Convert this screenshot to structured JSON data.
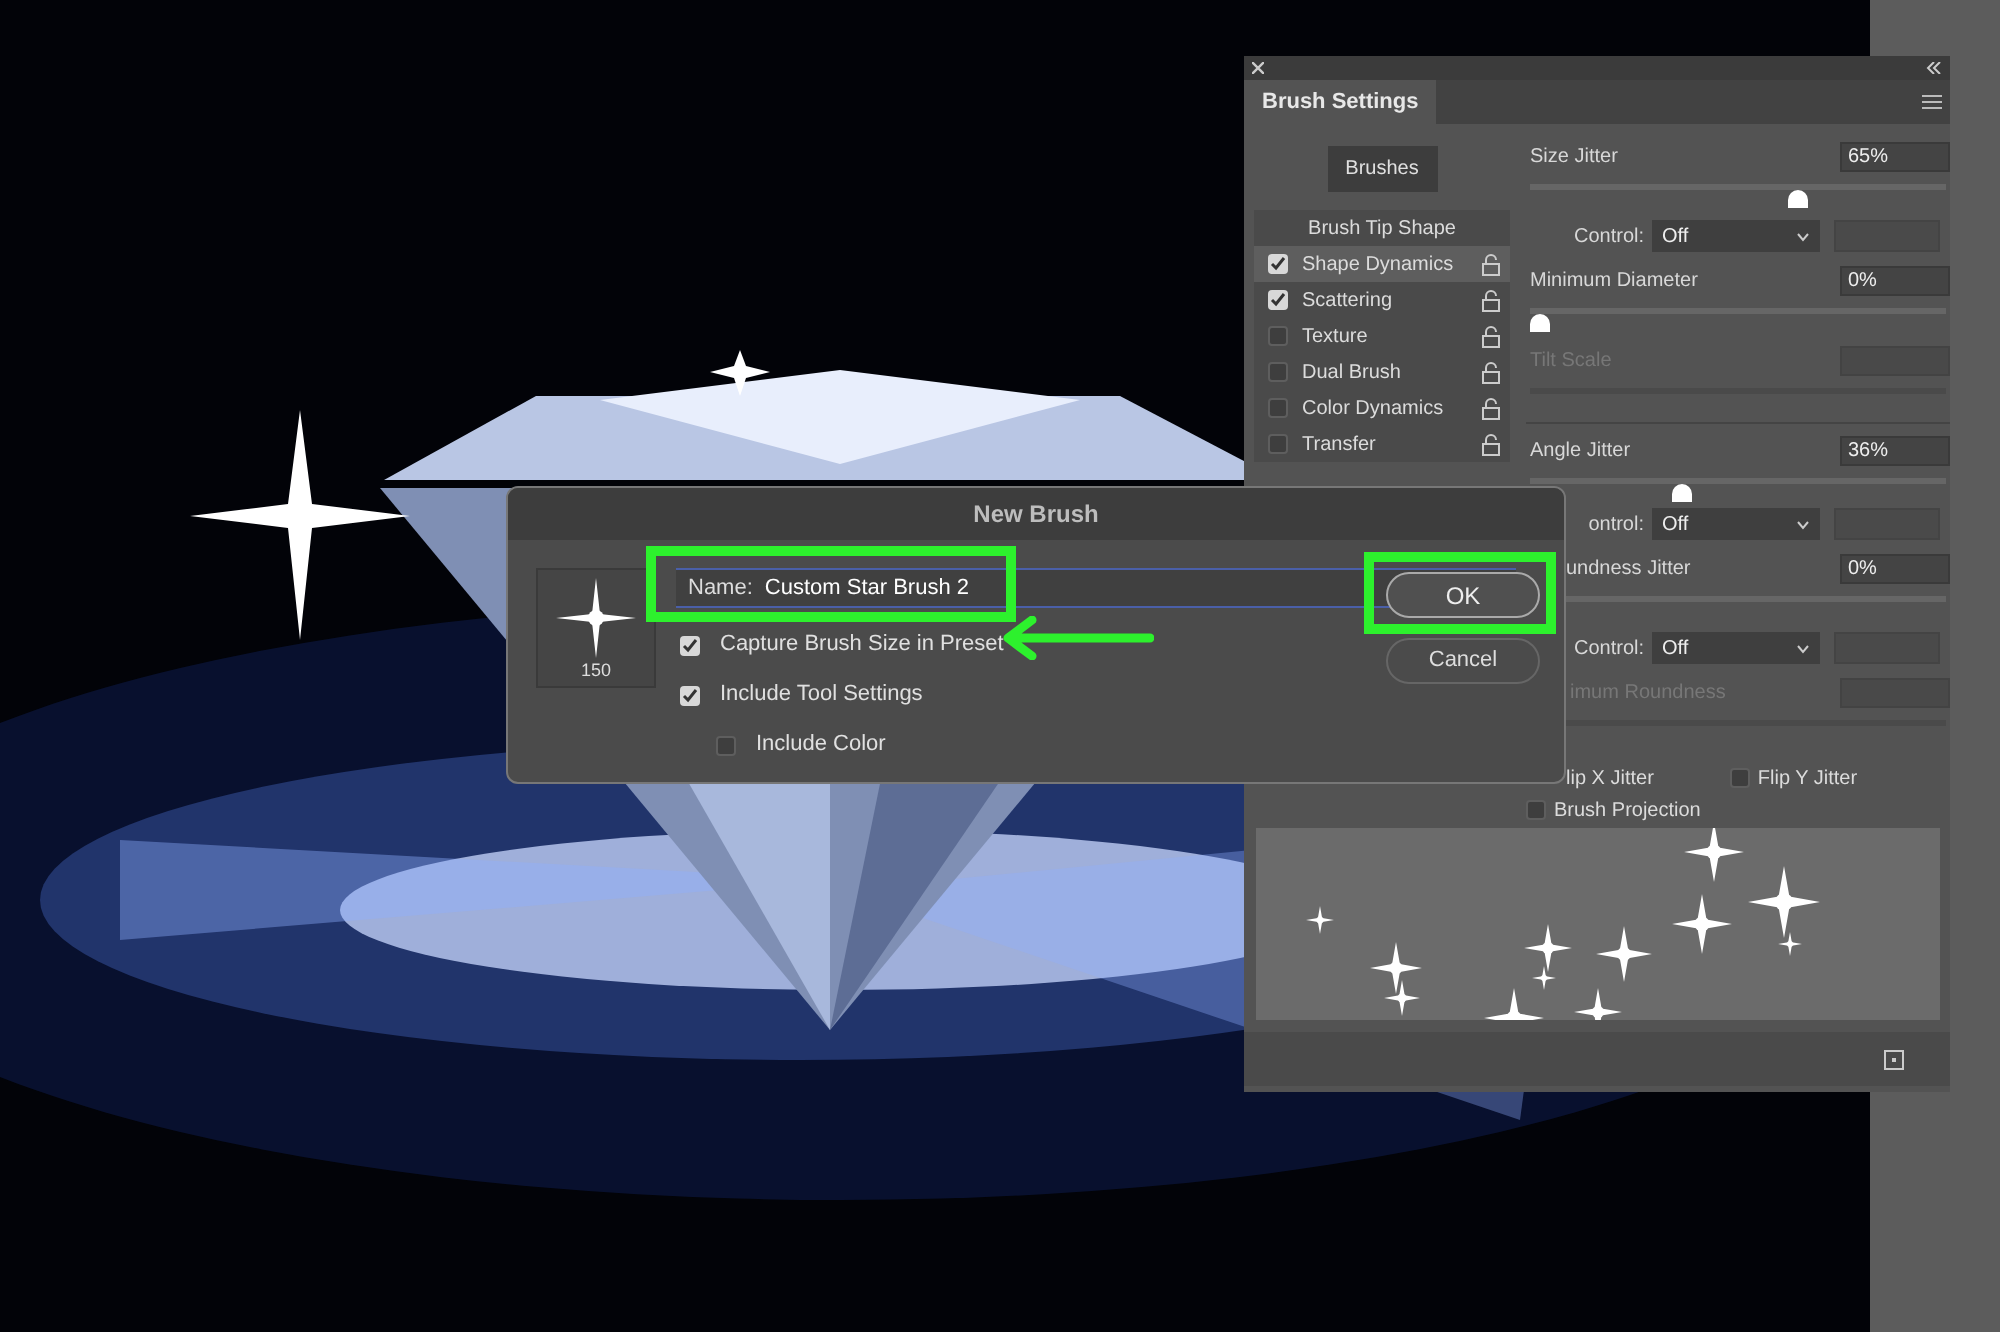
{
  "brush_settings": {
    "title": "Brush Settings",
    "brushes_button": "Brushes",
    "section_header": "Brush Tip Shape",
    "options": [
      {
        "label": "Shape Dynamics",
        "checked": true,
        "selected": true
      },
      {
        "label": "Scattering",
        "checked": true,
        "selected": false
      },
      {
        "label": "Texture",
        "checked": false,
        "selected": false
      },
      {
        "label": "Dual Brush",
        "checked": false,
        "selected": false
      },
      {
        "label": "Color Dynamics",
        "checked": false,
        "selected": false
      },
      {
        "label": "Transfer",
        "checked": false,
        "selected": false
      }
    ],
    "controls": [
      {
        "kind": "slider",
        "label": "Size Jitter",
        "value": "65%",
        "level": 0.65
      },
      {
        "kind": "dropdown",
        "label": "Control:",
        "value": "Off"
      },
      {
        "kind": "slider",
        "label": "Minimum Diameter",
        "value": "0%",
        "level": 0
      },
      {
        "kind": "slider",
        "label": "Tilt Scale",
        "disabled": true
      },
      {
        "kind": "slider",
        "label": "Angle Jitter",
        "value": "36%",
        "level": 0.36
      },
      {
        "kind": "dropdown",
        "label": "ontrol:",
        "value": "Off"
      },
      {
        "kind": "slider",
        "label": "undness Jitter",
        "value": "0%"
      },
      {
        "kind": "dropdown",
        "label": "Control:",
        "value": "Off"
      },
      {
        "kind": "slider",
        "label": "imum Roundness",
        "disabled": true
      }
    ],
    "flips": [
      {
        "label": "lip X Jitter"
      },
      {
        "label": "Flip Y Jitter",
        "checked": false
      }
    ],
    "projection": {
      "label": "Brush Projection",
      "checked": false
    }
  },
  "dialog": {
    "title": "New Brush",
    "preview_size": "150",
    "name_label": "Name:",
    "name_value": "Custom Star Brush 2",
    "options": [
      {
        "label": "Capture Brush Size in Preset",
        "checked": true
      },
      {
        "label": "Include Tool Settings",
        "checked": true
      },
      {
        "label": "Include Color",
        "checked": false
      }
    ],
    "buttons": [
      "OK",
      "Cancel"
    ]
  }
}
